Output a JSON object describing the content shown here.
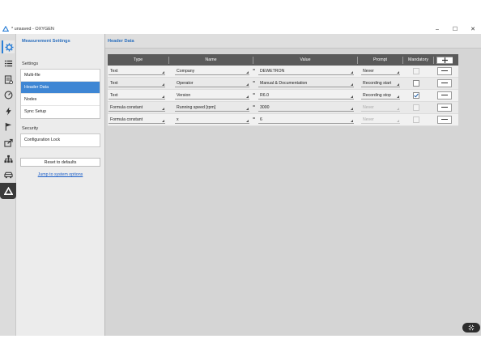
{
  "window": {
    "title": "* unsaved - OXYGEN",
    "minimize_glyph": "–",
    "maximize_glyph": "☐",
    "close_glyph": "✕"
  },
  "rail": {
    "icons": [
      "gear-icon",
      "list-icon",
      "checklist-icon",
      "gauge-icon",
      "lightning-icon",
      "flag-icon",
      "export-icon",
      "network-icon",
      "vehicle-icon",
      "dewetron-logo-icon"
    ]
  },
  "nav": {
    "panel_title": "Measurement Settings",
    "settings_label": "Settings",
    "settings_items": [
      "Multi-file",
      "Header Data",
      "Nodes",
      "Sync Setup"
    ],
    "selected_item": "Header Data",
    "security_label": "Security",
    "security_items": [
      "Configuration Lock"
    ],
    "reset_label": "Reset to defaults",
    "jump_link": "Jump to system options"
  },
  "main": {
    "title": "Header Data",
    "columns": [
      "Type",
      "Name",
      "Value",
      "Prompt",
      "Mandatory"
    ],
    "rows": [
      {
        "type": "Text",
        "name": "Company",
        "value": "DEWETRON",
        "prompt": "Never",
        "prompt_enabled": true,
        "mandatory": false,
        "mandatory_enabled": false
      },
      {
        "type": "Text",
        "name": "Operator",
        "value": "Manual & Documentation",
        "prompt": "Recording start",
        "prompt_enabled": true,
        "mandatory": false,
        "mandatory_enabled": true
      },
      {
        "type": "Text",
        "name": "Version",
        "value": "R6.0",
        "prompt": "Recording stop",
        "prompt_enabled": true,
        "mandatory": true,
        "mandatory_enabled": true
      },
      {
        "type": "Formula constant",
        "name": "Running speed [rpm]",
        "value": "3000",
        "prompt": "Never",
        "prompt_enabled": false,
        "mandatory": false,
        "mandatory_enabled": false
      },
      {
        "type": "Formula constant",
        "name": "x",
        "value": "6",
        "prompt": "Never",
        "prompt_enabled": false,
        "mandatory": false,
        "mandatory_enabled": false
      }
    ],
    "equals_sign": "="
  },
  "colors": {
    "accent": "#3e86d4",
    "header_text": "#2b6fbe",
    "grid_header": "#5a5a5a"
  }
}
